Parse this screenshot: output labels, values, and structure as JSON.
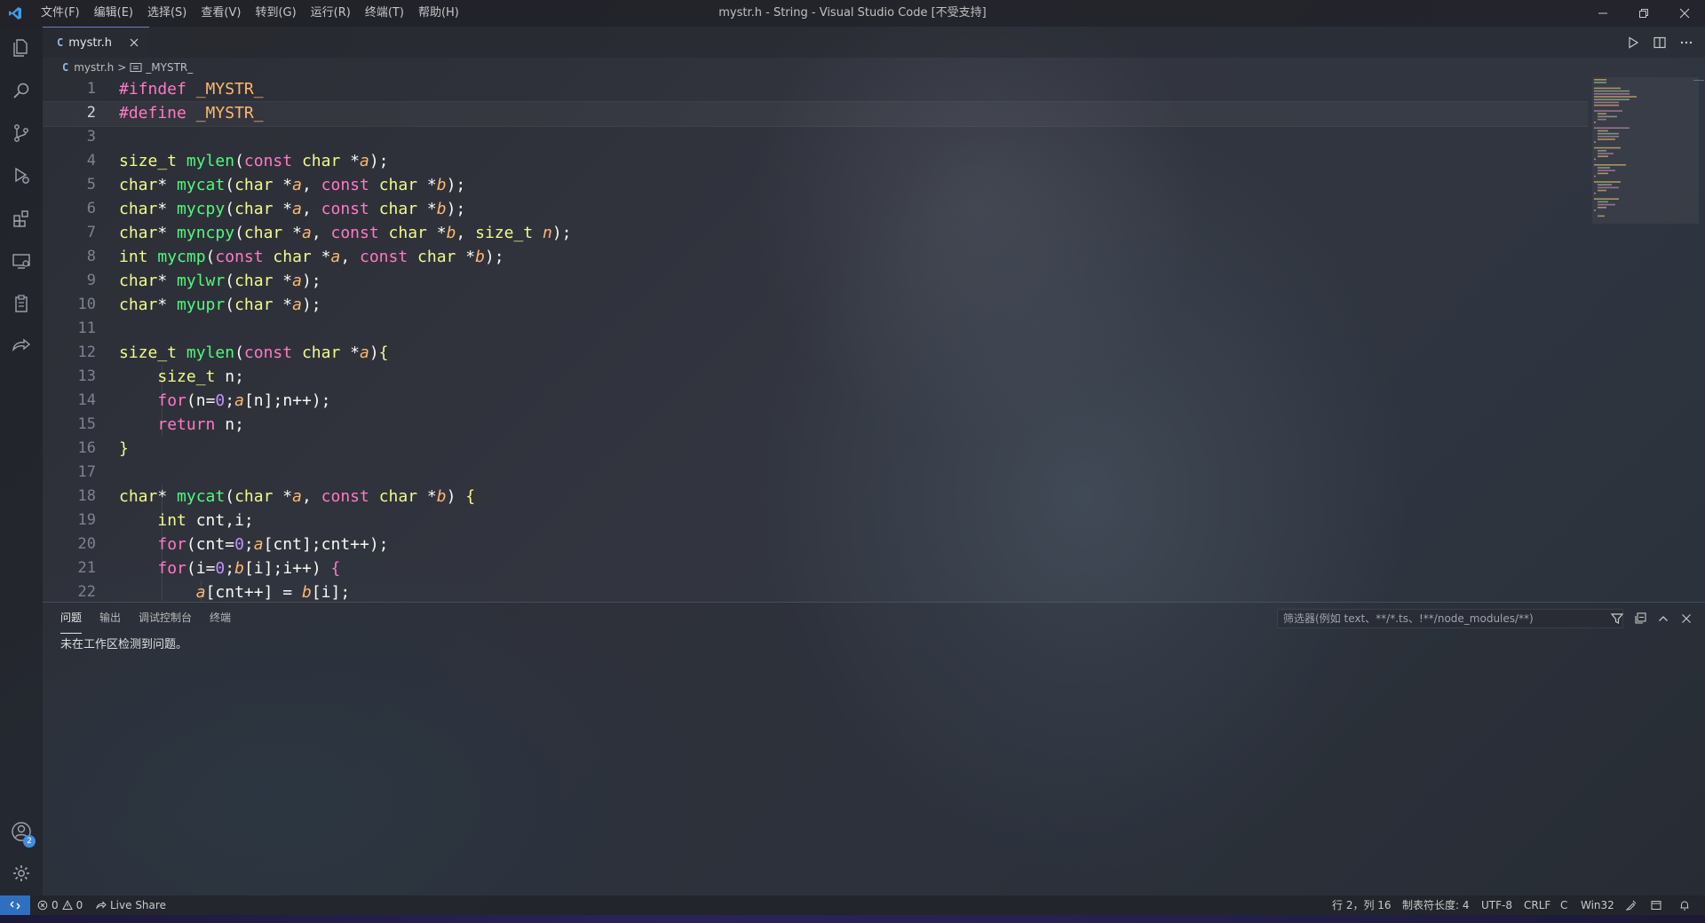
{
  "app": {
    "title": "mystr.h - String - Visual Studio Code [不受支持]",
    "menu": [
      "文件(F)",
      "编辑(E)",
      "选择(S)",
      "查看(V)",
      "转到(G)",
      "运行(R)",
      "终端(T)",
      "帮助(H)"
    ]
  },
  "activity": {
    "accounts_badge": "2"
  },
  "tab": {
    "icon_text": "C",
    "label": "mystr.h"
  },
  "breadcrumbs": {
    "file_icon_text": "C",
    "file": "mystr.h",
    "separator": ">",
    "symbol": "_MYSTR_"
  },
  "editor": {
    "line_numbers": [
      "1",
      "2",
      "3",
      "4",
      "5",
      "6",
      "7",
      "8",
      "9",
      "10",
      "11",
      "12",
      "13",
      "14",
      "15",
      "16",
      "17",
      "18",
      "19",
      "20",
      "21",
      "22"
    ],
    "active_line": 2
  },
  "panel": {
    "tabs": [
      "问题",
      "输出",
      "调试控制台",
      "终端"
    ],
    "active_tab": "问题",
    "filter_placeholder": "筛选器(例如 text、**/*.ts、!**/node_modules/**)",
    "message": "未在工作区检测到问题。"
  },
  "status": {
    "errors": "0",
    "warnings": "0",
    "live_share": "Live Share",
    "cursor_position": "行 2，列 16",
    "tab_size": "制表符长度: 4",
    "encoding": "UTF-8",
    "eol": "CRLF",
    "language": "C",
    "platform": "Win32"
  },
  "colors": {
    "accent": "#2f6fbf",
    "preprocessor": "#ff79c6",
    "type": "#f1fa8c",
    "function": "#50fa7b",
    "parameter": "#ffb86c",
    "number": "#bd93f9"
  }
}
